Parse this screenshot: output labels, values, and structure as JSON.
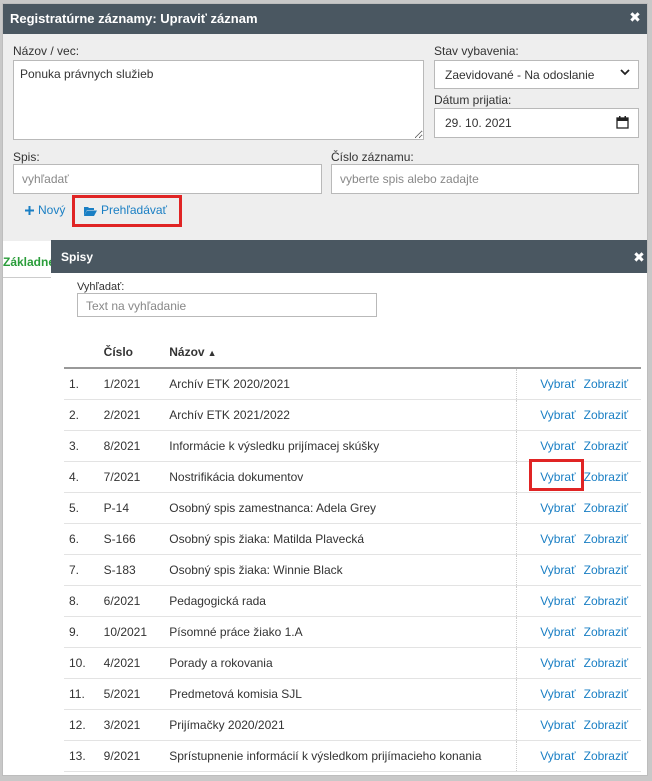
{
  "dialog": {
    "title": "Registratúrne záznamy: Upraviť záznam",
    "close": "✖"
  },
  "form": {
    "nazov_label": "Názov / vec:",
    "nazov_value": "Ponuka právnych služieb",
    "stav_label": "Stav vybavenia:",
    "stav_value": "Zaevidované - Na odoslanie",
    "datum_label": "Dátum prijatia:",
    "datum_value": "29. 10. 2021",
    "spis_label": "Spis:",
    "spis_placeholder": "vyhľadať",
    "cislo_label": "Číslo záznamu:",
    "cislo_placeholder": "vyberte spis alebo zadajte",
    "novy_label": "Nový",
    "prehladavat_label": "Prehľadávať"
  },
  "tab": {
    "label": "Základné"
  },
  "spisy": {
    "title": "Spisy",
    "close": "✖",
    "search_label": "Vyhľadať:",
    "search_placeholder": "Text na vyhľadanie",
    "columns": {
      "cislo": "Číslo",
      "nazov": "Názov"
    },
    "action_select": "Vybrať",
    "action_show": "Zobraziť",
    "rows": [
      {
        "n": "1.",
        "cislo": "1/2021",
        "nazov": "Archív ETK 2020/2021"
      },
      {
        "n": "2.",
        "cislo": "2/2021",
        "nazov": "Archív ETK 2021/2022"
      },
      {
        "n": "3.",
        "cislo": "8/2021",
        "nazov": "Informácie k výsledku prijímacej skúšky"
      },
      {
        "n": "4.",
        "cislo": "7/2021",
        "nazov": "Nostrifikácia dokumentov"
      },
      {
        "n": "5.",
        "cislo": "P-14",
        "nazov": "Osobný spis zamestnanca: Adela Grey"
      },
      {
        "n": "6.",
        "cislo": "S-166",
        "nazov": "Osobný spis žiaka: Matilda Plavecká"
      },
      {
        "n": "7.",
        "cislo": "S-183",
        "nazov": "Osobný spis žiaka: Winnie Black"
      },
      {
        "n": "8.",
        "cislo": "6/2021",
        "nazov": "Pedagogická rada"
      },
      {
        "n": "9.",
        "cislo": "10/2021",
        "nazov": "Písomné práce žiako 1.A"
      },
      {
        "n": "10.",
        "cislo": "4/2021",
        "nazov": "Porady a rokovania"
      },
      {
        "n": "11.",
        "cislo": "5/2021",
        "nazov": "Predmetová komisia SJL"
      },
      {
        "n": "12.",
        "cislo": "3/2021",
        "nazov": "Prijímačky 2020/2021"
      },
      {
        "n": "13.",
        "cislo": "9/2021",
        "nazov": "Sprístupnenie informácií k výsledkom prijímacieho konania"
      }
    ]
  },
  "colors": {
    "titlebar": "#4a5761",
    "link": "#1a7fc4",
    "highlight": "#e02424",
    "tab_active": "#2a9d3a"
  }
}
